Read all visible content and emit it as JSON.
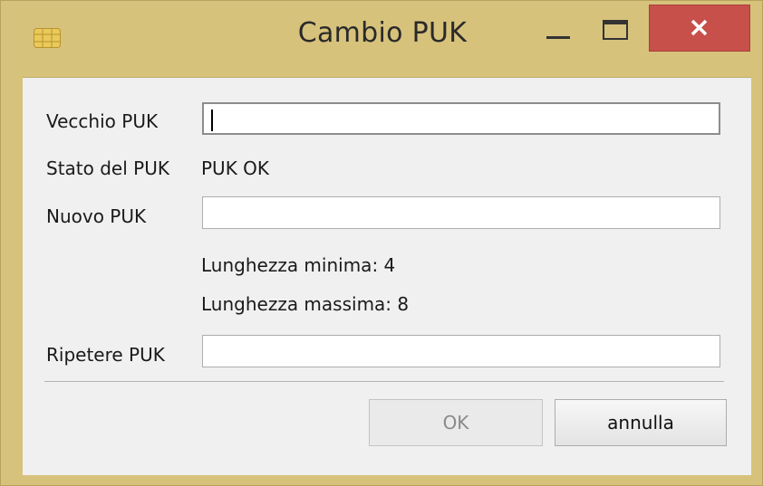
{
  "window": {
    "title": "Cambio PUK",
    "icon": "smartcard-chip-icon",
    "controls": [
      "minimize-icon",
      "maximize-icon",
      "close-icon"
    ],
    "close_color": "#c7504b"
  },
  "form": {
    "old_puk_label": "Vecchio PUK",
    "old_puk_value": "",
    "status_label": "Stato del PUK",
    "status_value": "PUK OK",
    "new_puk_label": "Nuovo PUK",
    "new_puk_value": "",
    "min_length_text": "Lunghezza minima: 4",
    "max_length_text": "Lunghezza massima: 8",
    "repeat_puk_label": "Ripetere PUK",
    "repeat_puk_value": ""
  },
  "buttons": {
    "ok_label": "OK",
    "cancel_label": "annulla"
  }
}
